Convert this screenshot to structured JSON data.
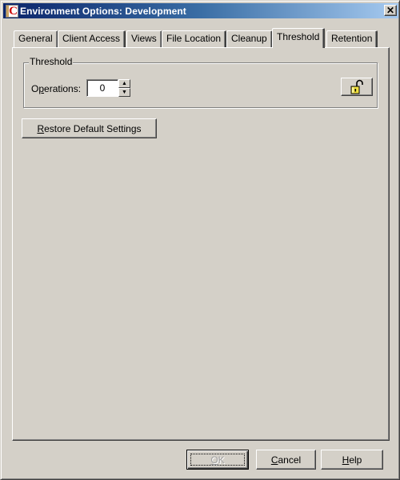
{
  "window": {
    "title": "Environment Options:  Development",
    "app_icon": "app-c-icon",
    "close_icon": "close-icon"
  },
  "tabs": [
    {
      "label": "General",
      "active": false
    },
    {
      "label": "Client Access",
      "active": false
    },
    {
      "label": "Views",
      "active": false
    },
    {
      "label": "File Location",
      "active": false
    },
    {
      "label": "Cleanup",
      "active": false
    },
    {
      "label": "Threshold",
      "active": true
    },
    {
      "label": "Retention",
      "active": false
    }
  ],
  "threshold_group": {
    "title": "Threshold",
    "operations_label_pre": "O",
    "operations_label_mnemonic": "p",
    "operations_label_post": "erations:",
    "operations_value": "0",
    "spin_up_icon": "arrow-up-icon",
    "spin_down_icon": "arrow-down-icon",
    "lock_icon": "unlocked-padlock-icon"
  },
  "restore_button": {
    "mnemonic": "R",
    "rest": "estore Default Settings"
  },
  "footer": {
    "ok": {
      "mnemonic": "O",
      "rest": "K",
      "disabled": true
    },
    "cancel": {
      "mnemonic": "C",
      "rest": "ancel"
    },
    "help": {
      "mnemonic": "H",
      "rest": "elp"
    }
  },
  "colors": {
    "title_gradient_start": "#0a246a",
    "title_gradient_end": "#a6caf0",
    "face": "#d4d0c8",
    "lock_yellow": "#f0e040"
  }
}
